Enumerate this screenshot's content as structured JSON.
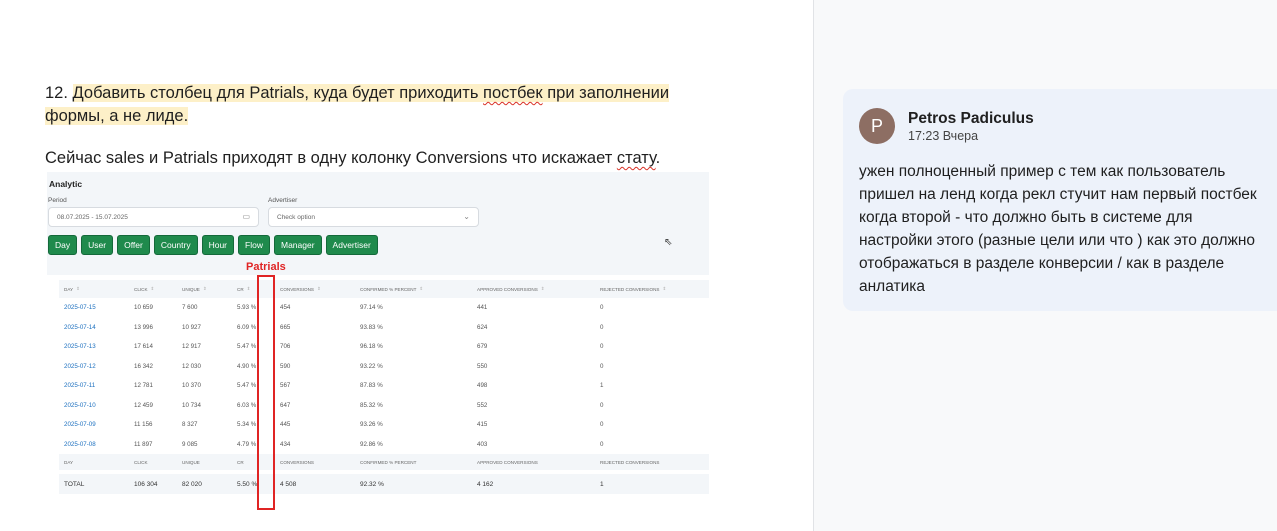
{
  "doc": {
    "para1": {
      "number": "12.",
      "t1": "Добавить столбец для Patrials, куда будет приходить",
      "t2": "постбек",
      "t3": "при заполнении формы, а не лиде."
    },
    "para2": {
      "t1": "Сейчас sales и Patrials приходят в одну колонку Conversions что искажает",
      "t2": "стату",
      "t3": "."
    }
  },
  "screenshot": {
    "title": "Analytic",
    "period_label": "Period",
    "period_value": "08.07.2025  -  15.07.2025",
    "advertiser_label": "Advertiser",
    "advertiser_placeholder": "Check option",
    "chips": [
      "Day",
      "User",
      "Offer",
      "Country",
      "Hour",
      "Flow",
      "Manager",
      "Advertiser"
    ],
    "annotation": "Patrials",
    "columns": [
      "DAY",
      "CLICK",
      "UNIQUE",
      "CR",
      "CONVERSIONS",
      "CONFIRMED % PERCENT",
      "APPROVED CONVERSIONS",
      "REJECTED CONVERSIONS"
    ],
    "rows": [
      [
        "2025-07-15",
        "10 659",
        "7 600",
        "5.93 %",
        "454",
        "97.14 %",
        "441",
        "0"
      ],
      [
        "2025-07-14",
        "13 996",
        "10 927",
        "6.09 %",
        "665",
        "93.83 %",
        "624",
        "0"
      ],
      [
        "2025-07-13",
        "17 614",
        "12 917",
        "5.47 %",
        "706",
        "96.18 %",
        "679",
        "0"
      ],
      [
        "2025-07-12",
        "16 342",
        "12 030",
        "4.90 %",
        "590",
        "93.22 %",
        "550",
        "0"
      ],
      [
        "2025-07-11",
        "12 781",
        "10 370",
        "5.47 %",
        "567",
        "87.83 %",
        "498",
        "1"
      ],
      [
        "2025-07-10",
        "12 459",
        "10 734",
        "6.03 %",
        "647",
        "85.32 %",
        "552",
        "0"
      ],
      [
        "2025-07-09",
        "11 156",
        "8 327",
        "5.34 %",
        "445",
        "93.26 %",
        "415",
        "0"
      ],
      [
        "2025-07-08",
        "11 897",
        "9 085",
        "4.79 %",
        "434",
        "92.86 %",
        "403",
        "0"
      ]
    ],
    "footer_columns": [
      "DAY",
      "CLICK",
      "UNIQUE",
      "CR",
      "CONVERSIONS",
      "CONFIRMED % PERCENT",
      "APPROVED CONVERSIONS",
      "REJECTED CONVERSIONS"
    ],
    "total": [
      "TOTAL",
      "106 304",
      "82 020",
      "5.50 %",
      "4 508",
      "92.32 %",
      "4 162",
      "1"
    ]
  },
  "comment": {
    "avatar_letter": "P",
    "author": "Petros Padiculus",
    "time": "17:23 Вчера",
    "text": "ужен полноценный пример с тем как пользователь пришел на ленд когда рекл стучит нам первый постбек когда второй - что должно быть в системе для настройки этого (разные цели или что ) как это должно отображаться в разделе конверсии / как в разделе анлатика"
  }
}
